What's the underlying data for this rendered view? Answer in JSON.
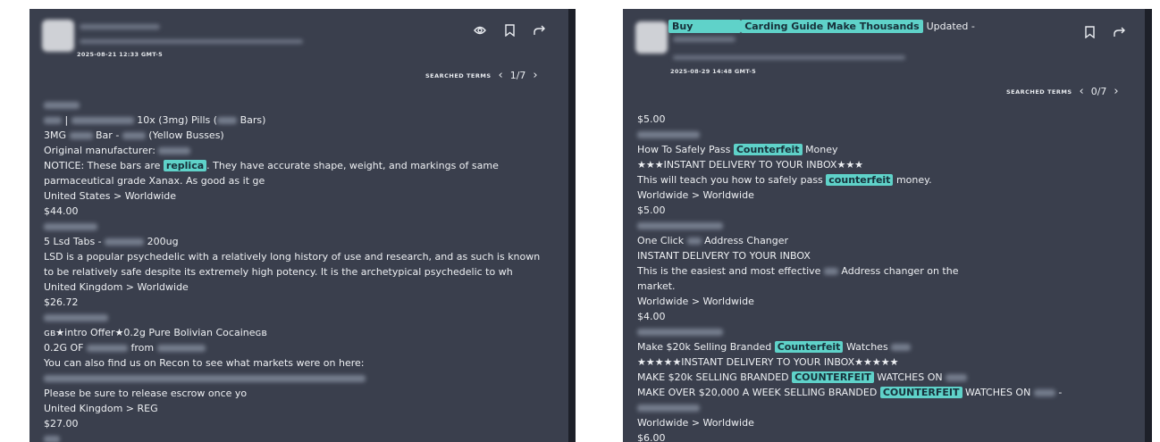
{
  "left": {
    "date": "2025-08-21 12:33 GMT-5",
    "nav": {
      "label": "SEARCHED TERMS",
      "counter": "1/7",
      "prev": "‹",
      "next": "›"
    },
    "lines": [
      {
        "pre": "",
        "parts": []
      },
      {
        "text_a": "|",
        "text_b": "10x (3mg) Pills (",
        "text_c": "Bars)"
      },
      {
        "text_a": "3MG",
        "text_b": "Bar -",
        "text_c": "(Yellow Busses)"
      },
      {
        "text_a": "Original manufacturer:"
      },
      {
        "text_a": "NOTICE: These bars are",
        "hl": "replica",
        "text_b": ". They have accurate shape, weight, and markings of same"
      },
      {
        "text_a": "parmaceutical grade Xanax. As good as it ge"
      },
      {
        "text_a": "United States > Worldwide"
      },
      {
        "text_a": "$44.00"
      },
      {
        "text_a": ""
      },
      {
        "text_a": "5 Lsd Tabs -",
        "text_b": "200ug"
      },
      {
        "text_a": "LSD is a popular psychedelic with a relatively long history of use and research, and as such is known"
      },
      {
        "text_a": "to be relatively safe despite its extremely high potency. It is the archetypical psychedelic to wh"
      },
      {
        "text_a": "United Kingdom > Worldwide"
      },
      {
        "text_a": "$26.72"
      },
      {
        "text_a": ""
      },
      {
        "text_a": "ɢʙ★intro Offer★0.2g Pure Bolivian Cocaineɢʙ"
      },
      {
        "text_a": "0.2G OF",
        "text_b": "from"
      },
      {
        "text_a": "You can also find us on Recon to see what markets were on here:"
      },
      {
        "text_a": ""
      },
      {
        "text_a": "Please be sure to release escrow once yo"
      },
      {
        "text_a": "United Kingdom > REG"
      },
      {
        "text_a": "$27.00"
      }
    ]
  },
  "right": {
    "title": {
      "w1": "Buy",
      "w2": "Carding Guide Make Thousands",
      "tail": "Updated -"
    },
    "date": "2025-08-29 14:48 GMT-5",
    "nav": {
      "label": "SEARCHED TERMS",
      "counter": "0/7",
      "prev": "‹",
      "next": "›"
    },
    "lines": [
      {
        "text_a": "$5.00"
      },
      {
        "text_a": ""
      },
      {
        "text_a": "How To Safely Pass",
        "hl": "Counterfeit",
        "text_b": "Money"
      },
      {
        "text_a": "★★★INSTANT DELIVERY TO YOUR INBOX★★★"
      },
      {
        "text_a": "This will teach you how to safely pass",
        "hl": "counterfeit",
        "text_b": "money."
      },
      {
        "text_a": "Worldwide > Worldwide"
      },
      {
        "text_a": "$5.00"
      },
      {
        "text_a": ""
      },
      {
        "text_a": "One Click",
        "text_b": "Address Changer"
      },
      {
        "text_a": "INSTANT DELIVERY TO YOUR INBOX"
      },
      {
        "text_a": "This is the easiest and most effective",
        "text_b": "Address changer on the"
      },
      {
        "text_a": "market."
      },
      {
        "text_a": "Worldwide > Worldwide"
      },
      {
        "text_a": "$4.00"
      },
      {
        "text_a": ""
      },
      {
        "text_a": "Make $20k Selling Branded",
        "hl": "Counterfeit",
        "text_b": "Watches"
      },
      {
        "text_a": "★★★★★INSTANT DELIVERY TO YOUR INBOX★★★★★"
      },
      {
        "text_a": "MAKE $20k SELLING BRANDED",
        "hl": "COUNTERFEIT",
        "text_b": "WATCHES ON"
      },
      {
        "text_a": "MAKE OVER $20,000 A WEEK SELLING BRANDED",
        "hl": "COUNTERFEIT",
        "text_b": "WATCHES ON",
        "text_c": "-"
      },
      {
        "text_a": ""
      },
      {
        "text_a": "Worldwide > Worldwide"
      },
      {
        "text_a": "$6.00"
      }
    ]
  }
}
